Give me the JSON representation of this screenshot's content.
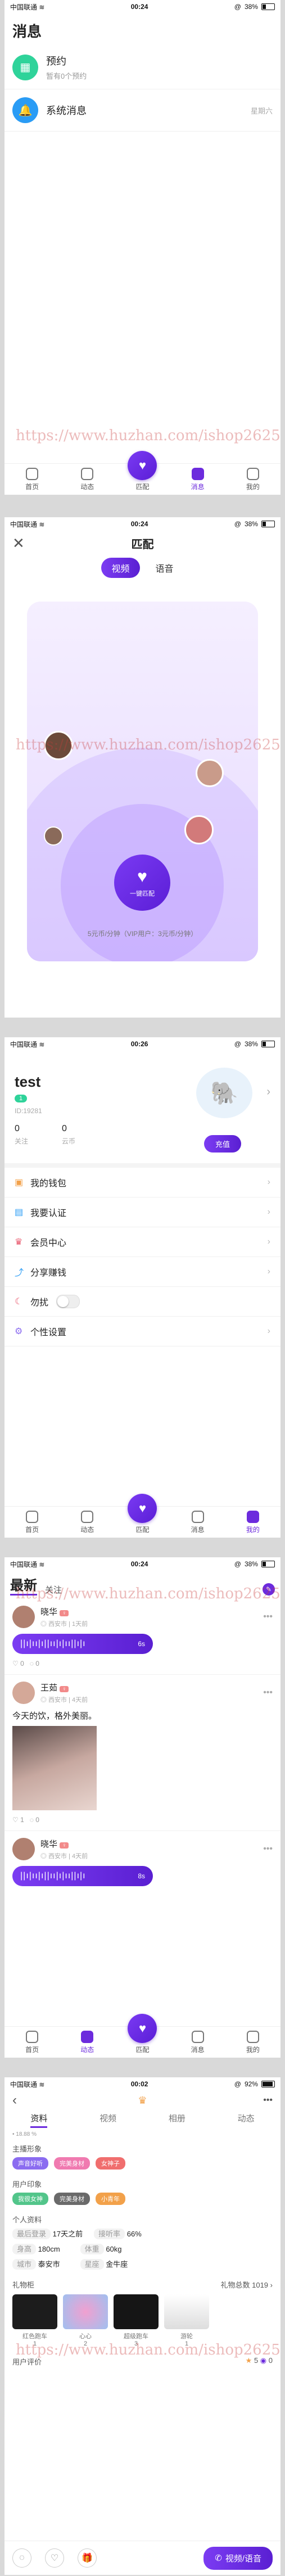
{
  "statusbar": {
    "carrier": "中国联通",
    "wifi": "wifi",
    "times": [
      "00:24",
      "00:24",
      "00:26",
      "00:24",
      "00:02"
    ],
    "batteries": [
      "38%",
      "38%",
      "38%",
      "38%",
      "92%"
    ]
  },
  "tabs": {
    "home": "首页",
    "feed": "动态",
    "match": "匹配",
    "message": "消息",
    "mine": "我的"
  },
  "messages": {
    "title": "消息",
    "items": [
      {
        "title": "预约",
        "sub": "暂有0个预约",
        "time": "",
        "color": "#2fd39a"
      },
      {
        "title": "系统消息",
        "sub": "",
        "time": "星期六",
        "color": "#2a9cf5"
      }
    ]
  },
  "match": {
    "title": "匹配",
    "segment": [
      "视频",
      "语音"
    ],
    "button": "一键匹配",
    "price": "5元币/分钟（VIP用户：3元币/分钟）"
  },
  "profile": {
    "name": "test",
    "level": "1",
    "id": "ID:19281",
    "stats": [
      {
        "value": "0",
        "label": "关注"
      },
      {
        "value": "0",
        "label": "云币"
      }
    ],
    "recharge": "充值",
    "menu": [
      "我的钱包",
      "我要认证",
      "会员中心",
      "分享赚钱",
      "勿扰",
      "个性设置"
    ]
  },
  "feed": {
    "tabs": [
      "最新",
      "关注"
    ],
    "posts": [
      {
        "name": "晓华",
        "city": "西安市",
        "ago": "1天前",
        "audio": "6s",
        "likes": "0",
        "comments": "0",
        "text": ""
      },
      {
        "name": "王茹",
        "city": "西安市",
        "ago": "4天前",
        "audio": "",
        "likes": "1",
        "comments": "0",
        "text": "今天的饮，格外美丽。"
      },
      {
        "name": "晓华",
        "city": "西安市",
        "ago": "4天前",
        "audio": "8s",
        "likes": "",
        "comments": "",
        "text": ""
      }
    ]
  },
  "detail": {
    "tabs": [
      "资料",
      "视频",
      "相册",
      "动态"
    ],
    "small_text": "• 18.88 %",
    "sections": {
      "tags_title": "主播形象",
      "impression_title": "用户印象",
      "info_title": "个人资料",
      "gifts_title": "礼物柜",
      "gifts_total": "礼物总数 1019",
      "eval_title": "用户评价",
      "rating": "5",
      "eval_count": "0"
    },
    "tags": [
      {
        "text": "声音好听",
        "color": "#8b6cf0"
      },
      {
        "text": "完美身材",
        "color": "#f07ab0"
      },
      {
        "text": "女神子",
        "color": "#f06e6e"
      }
    ],
    "impressions": [
      {
        "text": "我很女神",
        "color": "#52c58a"
      },
      {
        "text": "完美身材",
        "color": "#6a6a6a"
      },
      {
        "text": "小青年",
        "color": "#f2a14a"
      }
    ],
    "info": [
      [
        {
          "k": "最后登录",
          "v": "17天之前"
        },
        {
          "k": "接听率",
          "v": "66%"
        }
      ],
      [
        {
          "k": "身高",
          "v": "180cm"
        },
        {
          "k": "体重",
          "v": "60kg"
        }
      ],
      [
        {
          "k": "城市",
          "v": "泰安市"
        },
        {
          "k": "星座",
          "v": "金牛座"
        }
      ]
    ],
    "gifts": [
      {
        "name": "红色跑车",
        "count": "1"
      },
      {
        "name": "心心",
        "count": "2"
      },
      {
        "name": "超级跑车",
        "count": "3"
      },
      {
        "name": "游轮",
        "count": "1"
      }
    ],
    "call": "视频/语音"
  },
  "watermark": "https://www.huzhan.com/ishop26250"
}
